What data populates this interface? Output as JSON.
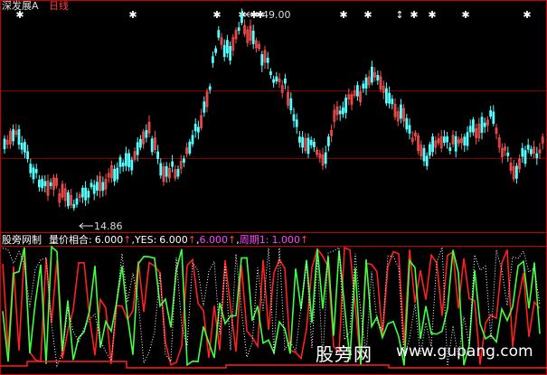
{
  "header": {
    "stock_name": "深发展A",
    "period": "日线"
  },
  "price_panel": {
    "high_label": "49.00",
    "low_label": "14.86"
  },
  "indicator_panel": {
    "name": "股旁网制",
    "params": [
      {
        "label": "量价相合:",
        "value": "6.000",
        "arrow": "↑",
        "color": "#ffffff"
      },
      {
        "label": "YES:",
        "value": "6.000",
        "arrow": "↑",
        "color": "#ffffff"
      },
      {
        "label": "",
        "value": "6.000",
        "arrow": "↑",
        "color": "#ff44ff"
      },
      {
        "label": "周期1:",
        "value": "1.000",
        "arrow": "↑",
        "color": "#ff44ff"
      }
    ]
  },
  "watermark": {
    "cn": "股旁网",
    "url": "www.gupang.com"
  },
  "colors": {
    "background": "#000000",
    "frame": "#c80000",
    "up_candle": "#ff5050",
    "down_candle": "#54ffff",
    "ind_red": "#ff2020",
    "ind_green": "#40ff40",
    "ind_dots": "#ffffff",
    "magenta": "#ff44ff"
  }
}
